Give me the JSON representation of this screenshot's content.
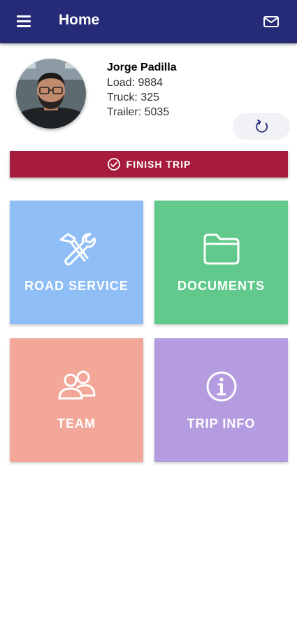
{
  "header": {
    "title": "Home",
    "menu_icon": "hamburger-menu-icon",
    "mail_icon": "mail-icon",
    "background": "#262b78"
  },
  "profile": {
    "name": "Jorge Padilla",
    "load": "Load: 9884",
    "truck": "Truck: 325",
    "trailer": "Trailer: 5035",
    "refresh_icon": "refresh-icon"
  },
  "finish_trip": {
    "label": "FINISH TRIP",
    "icon": "check-circle-icon",
    "color": "#a71c3c"
  },
  "tiles": [
    {
      "label": "ROAD SERVICE",
      "icon": "tools-icon",
      "color": "#8fbef7"
    },
    {
      "label": "DOCUMENTS",
      "icon": "folder-icon",
      "color": "#61c98b"
    },
    {
      "label": "TEAM",
      "icon": "team-icon",
      "color": "#f2a799"
    },
    {
      "label": "TRIP INFO",
      "icon": "info-icon",
      "color": "#b59ce0"
    }
  ]
}
